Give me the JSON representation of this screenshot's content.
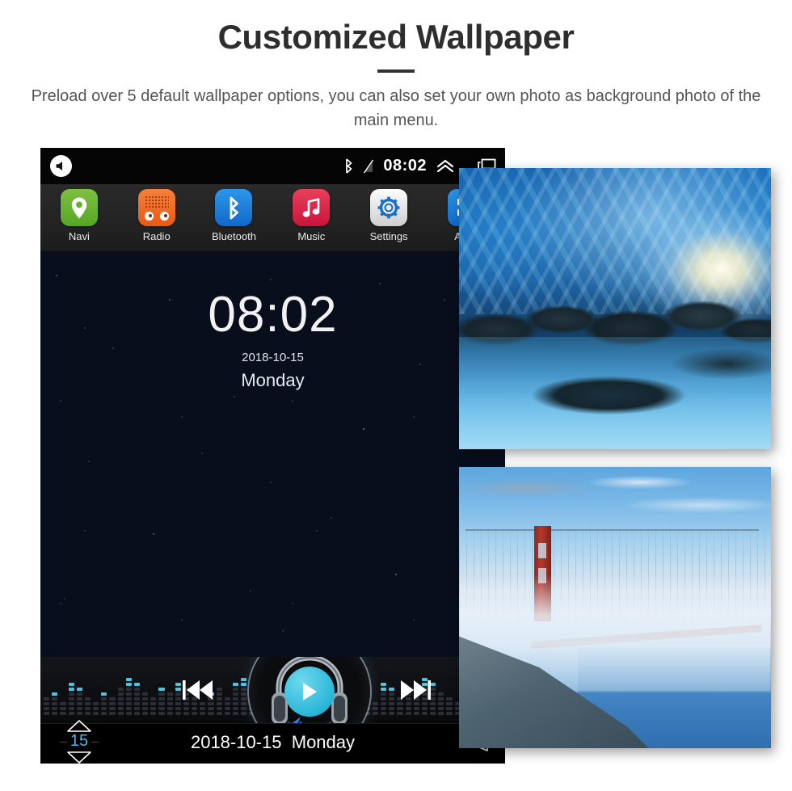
{
  "header": {
    "title": "Customized Wallpaper",
    "subtitle": "Preload over 5 default wallpaper options, you can also set your own photo as background photo of the main menu."
  },
  "device": {
    "status_bar": {
      "speaker_icon": "speaker-mute-icon",
      "bluetooth_icon": "bluetooth-icon",
      "no_sim_icon": "no-signal-icon",
      "time": "08:02",
      "chevron_up_icon": "double-chevron-up-icon",
      "recent_apps_icon": "recent-apps-icon"
    },
    "dock": {
      "apps": [
        {
          "label": "Navi",
          "icon": "location-pin-icon",
          "color": "#64b12e"
        },
        {
          "label": "Radio",
          "icon": "radio-speaker-icon",
          "color": "#ea5a14"
        },
        {
          "label": "Bluetooth",
          "icon": "bluetooth-icon",
          "color": "#1268c9"
        },
        {
          "label": "Music",
          "icon": "music-note-icon",
          "color": "#c9143c"
        },
        {
          "label": "Settings",
          "icon": "gear-icon",
          "color": "#e8e8e8"
        },
        {
          "label": "Apps",
          "icon": "apps-grid-icon",
          "color": "#1268c9"
        }
      ]
    },
    "wallpaper": {
      "name": "starry-night-wallpaper",
      "clock": "08:02",
      "date": "2018-10-15",
      "weekday": "Monday"
    },
    "player": {
      "prev_label": "previous-track",
      "play_label": "play",
      "next_label": "next-track",
      "equalizer": [
        [
          4,
          0
        ],
        [
          5,
          1
        ],
        [
          3,
          0
        ],
        [
          7,
          2
        ],
        [
          6,
          1
        ],
        [
          4,
          0
        ],
        [
          3,
          0
        ],
        [
          5,
          1
        ],
        [
          4,
          0
        ],
        [
          6,
          0
        ],
        [
          8,
          2
        ],
        [
          7,
          1
        ],
        [
          5,
          0
        ],
        [
          4,
          0
        ],
        [
          6,
          1
        ],
        [
          5,
          0
        ],
        [
          7,
          2
        ],
        [
          6,
          0
        ],
        [
          4,
          0
        ],
        [
          3,
          0
        ],
        [
          5,
          1
        ],
        [
          6,
          0
        ],
        [
          4,
          0
        ],
        [
          7,
          1
        ],
        [
          8,
          2
        ],
        [
          6,
          0
        ],
        [
          5,
          1
        ],
        [
          4,
          0
        ],
        [
          3,
          0
        ],
        [
          6,
          0
        ],
        [
          7,
          1
        ],
        [
          5,
          0
        ],
        [
          4,
          0
        ],
        [
          6,
          2
        ],
        [
          8,
          1
        ],
        [
          7,
          0
        ],
        [
          5,
          0
        ],
        [
          4,
          1
        ],
        [
          6,
          0
        ],
        [
          5,
          0
        ],
        [
          3,
          0
        ],
        [
          7,
          2
        ],
        [
          6,
          1
        ],
        [
          4,
          0
        ],
        [
          5,
          0
        ],
        [
          6,
          0
        ],
        [
          8,
          2
        ],
        [
          7,
          1
        ],
        [
          5,
          0
        ],
        [
          4,
          0
        ],
        [
          3,
          0
        ],
        [
          6,
          1
        ],
        [
          7,
          0
        ],
        [
          5,
          0
        ],
        [
          4,
          0
        ],
        [
          6,
          2
        ]
      ]
    },
    "bottom_bar": {
      "volume_up_icon": "triangle-up-icon",
      "volume_value": "15",
      "volume_down_icon": "triangle-down-icon",
      "date": "2018-10-15",
      "weekday": "Monday",
      "back_icon": "back-arrow-icon"
    }
  },
  "photos": [
    {
      "name": "ice-cave-wallpaper",
      "alt": "Blue glacial ice cave with stream over rocks"
    },
    {
      "name": "golden-gate-bridge-wallpaper",
      "alt": "Golden Gate Bridge emerging from fog"
    }
  ]
}
